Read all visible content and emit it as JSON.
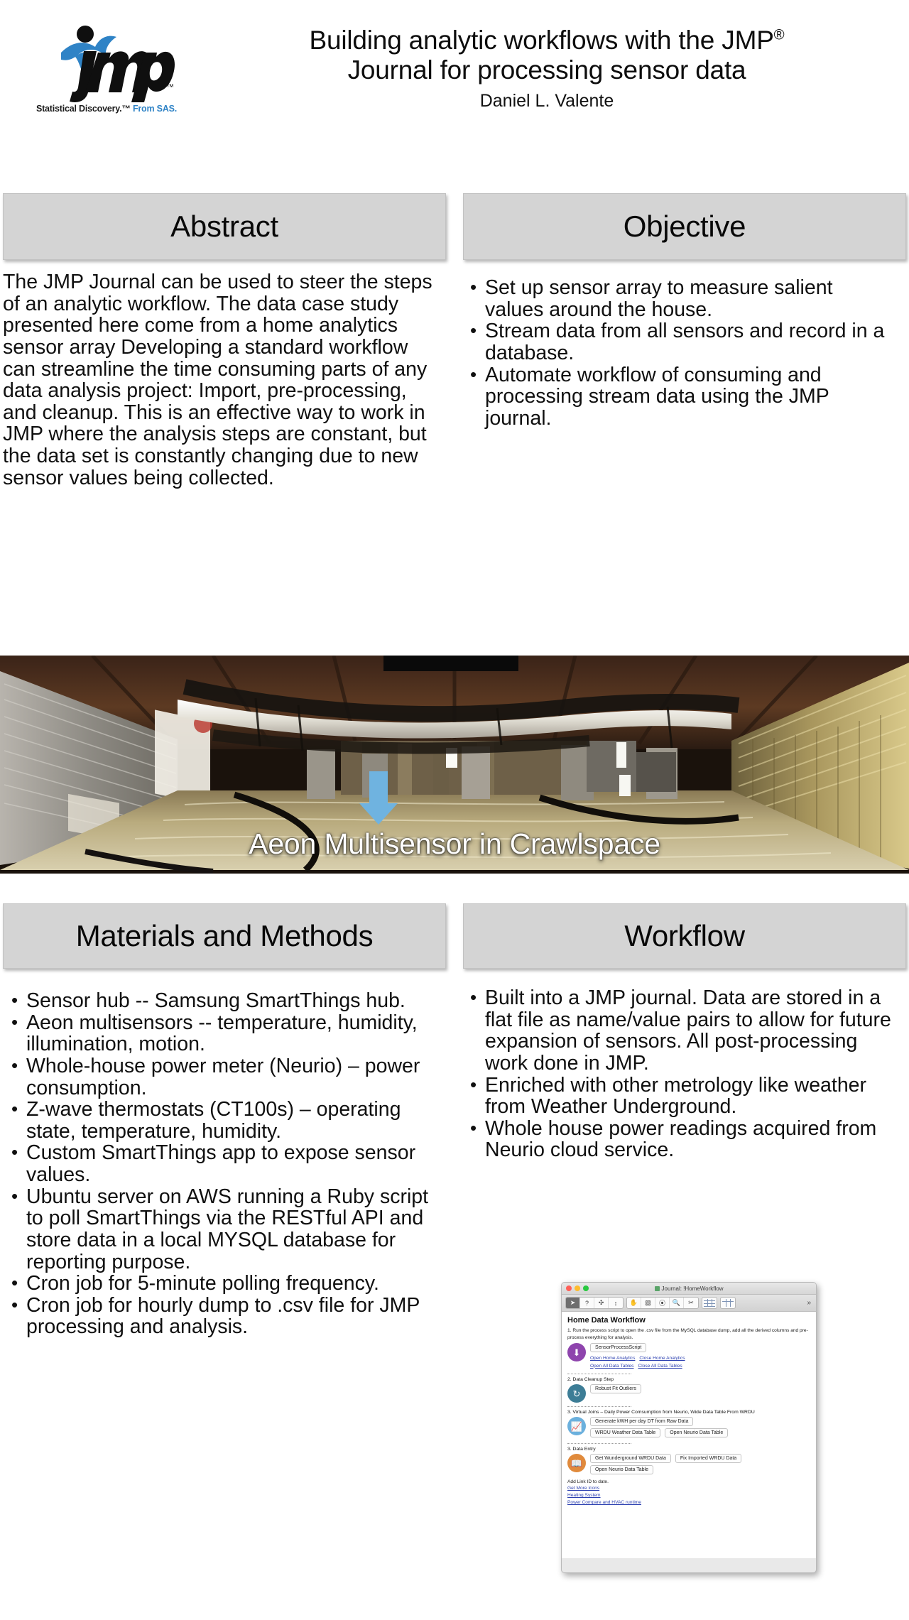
{
  "header": {
    "logo_alt": "JMP Statistical Discovery From SAS",
    "logo_tagline_dark": "Statistical Discovery.™",
    "logo_tagline_blue": "From SAS.",
    "title_line1": "Building analytic workflows with the JMP",
    "title_superscript": "®",
    "title_line2": "Journal for processing sensor data",
    "author": "Daniel L. Valente"
  },
  "sections": {
    "abstract": {
      "heading": "Abstract",
      "body": "The JMP Journal can be used to steer the steps of an analytic workflow. The data case study presented here come from a home analytics sensor array Developing a standard workflow can streamline the time consuming parts of any data analysis project: Import, pre-processing, and cleanup. This is an effective way to work in JMP where the analysis steps are constant, but the data set is constantly changing due to new sensor values being collected."
    },
    "objective": {
      "heading": "Objective",
      "bullets": [
        "Set up sensor array to measure salient values around the house.",
        "Stream data from all sensors and record in a database.",
        "Automate workflow of consuming and processing stream data using the JMP journal."
      ]
    },
    "materials": {
      "heading": "Materials and Methods",
      "bullets": [
        "Sensor hub -- Samsung SmartThings hub.",
        "Aeon multisensors -- temperature, humidity, illumination, motion.",
        "Whole-house power meter (Neurio) – power consumption.",
        "Z-wave thermostats (CT100s) – operating state, temperature, humidity.",
        "Custom SmartThings app to expose sensor values.",
        "Ubuntu server on AWS running a Ruby script to poll SmartThings via the RESTful API and store data in a local MYSQL database for reporting purpose.",
        "Cron job for 5-minute polling frequency.",
        "Cron job for hourly dump to .csv file for JMP processing and analysis."
      ]
    },
    "workflow": {
      "heading": "Workflow",
      "bullets": [
        "Built into a JMP journal. Data are stored in a flat file as name/value pairs to allow for future expansion of sensors. All post-processing work done in JMP.",
        "Enriched with other metrology like weather from Weather Underground.",
        "Whole house power readings acquired from Neurio cloud service."
      ]
    }
  },
  "photo": {
    "caption": "Aeon Multisensor in Crawlspace",
    "alt": "Photograph of a home crawlspace with foil insulation, ducts and pipes, with a blue arrow pointing at a sensor"
  },
  "journal": {
    "window_title": "Journal: !HomeWorkflow",
    "window_title_icon": "journal-icon",
    "toolbar": {
      "tools": [
        "arrow",
        "question",
        "crosshair",
        "resize",
        "hand",
        "brush",
        "lasso",
        "magnifier",
        "scissors"
      ],
      "overflow": "»"
    },
    "heading": "Home Data Workflow",
    "step1_text": "1. Run the process script to open the .csv file from the MySQL database dump, add all the derived columns and pre-process everything for analysis.",
    "step1_button": "SensorProcessScript",
    "step1_links_row1": [
      "Open Home Analytics",
      "Close Home Analytics"
    ],
    "step1_links_row2": [
      "Open All Data Tables",
      "Close All Data Tables"
    ],
    "step2_title": "2. Data Cleanup Step",
    "step2_button": "Robust Fit Outliers",
    "step3_title": "3. Virtual Joins – Daily Power Comsumption from Neurio, Wide Data Table From WRDU",
    "step3_button1": "Generate kWH per day DT from Raw Data",
    "step3_button2": "WRDU Weather Data Table",
    "step3_button3": "Open Neurio Data Table",
    "step4_title": "3. Data Entry",
    "step4_button1": "Get Wunderground WRDU Data",
    "step4_button2": "Fix Imported WRDU Data",
    "step4_button3": "Open Neurio Data Table",
    "note": "Add Link ID to date.",
    "footer_links": [
      "Get More Icons",
      "Heating System",
      "Power Compare and HVAC runtime"
    ]
  },
  "colors": {
    "bar_bg": "#d4d4d4",
    "text": "#101010",
    "logo_blue": "#2f83c6",
    "link": "#2b3fb0",
    "icon_purple": "#8e44ad",
    "icon_teal": "#3d7d96",
    "icon_blue": "#6bb0dd",
    "icon_orange": "#e08a3c"
  }
}
